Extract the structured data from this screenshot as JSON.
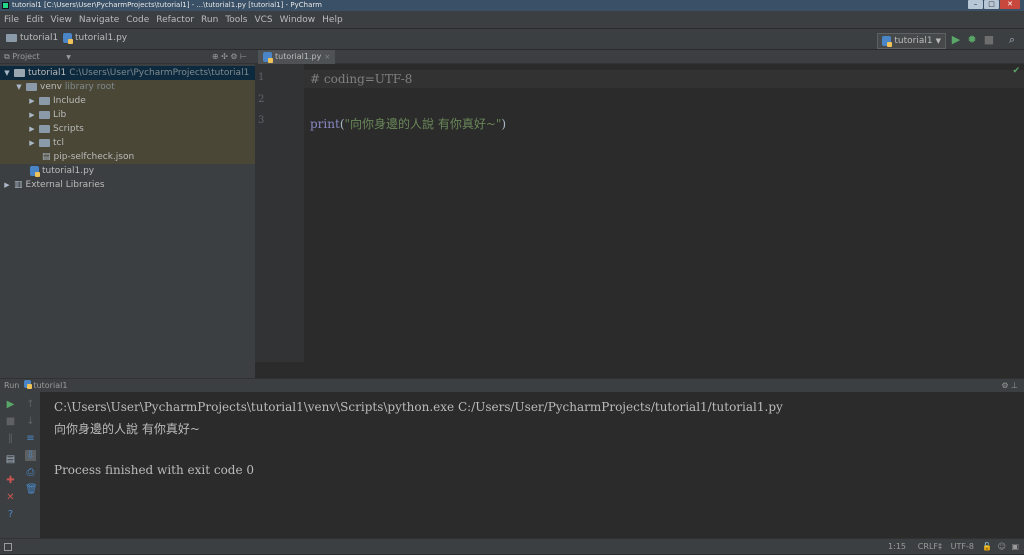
{
  "window": {
    "title": "tutorial1 [C:\\Users\\User\\PycharmProjects\\tutorial1] - ...\\tutorial1.py [tutorial1] - PyCharm"
  },
  "menu": [
    "File",
    "Edit",
    "View",
    "Navigate",
    "Code",
    "Refactor",
    "Run",
    "Tools",
    "VCS",
    "Window",
    "Help"
  ],
  "breadcrumbs": {
    "project": "tutorial1",
    "file": "tutorial1.py"
  },
  "run_config": {
    "name": "tutorial1"
  },
  "project_panel": {
    "header": "Project",
    "tree": [
      {
        "label": "tutorial1",
        "extra": "C:\\Users\\User\\PycharmProjects\\tutorial1"
      },
      {
        "label": "venv",
        "extra": "library root"
      },
      {
        "label": "Include"
      },
      {
        "label": "Lib"
      },
      {
        "label": "Scripts"
      },
      {
        "label": "tcl"
      },
      {
        "label": "pip-selfcheck.json"
      },
      {
        "label": "tutorial1.py"
      },
      {
        "label": "External Libraries"
      }
    ]
  },
  "editor": {
    "tab": "tutorial1.py",
    "line_numbers": [
      "1",
      "2",
      "3"
    ],
    "lines": {
      "comment": "# coding=UTF-8",
      "print_func": "print",
      "paren_open": "(",
      "string": "\"向你身邊的人說 有你真好~\"",
      "paren_close": ")"
    }
  },
  "run_panel": {
    "header_label": "Run",
    "config": "tutorial1",
    "console": [
      "C:\\Users\\User\\PycharmProjects\\tutorial1\\venv\\Scripts\\python.exe C:/Users/User/PycharmProjects/tutorial1/tutorial1.py",
      "向你身邊的人說 有你真好~",
      "",
      "Process finished with exit code 0"
    ]
  },
  "status_bar": {
    "position": "1:15",
    "line_sep": "CRLF",
    "encoding": "UTF-8"
  },
  "colors": {
    "background": "#2b2b2b",
    "panel": "#3c3f41",
    "selection": "#0d293e",
    "comment": "#808080",
    "keyword_func": "#8888c6",
    "string": "#6a8759",
    "run_green": "#59a869"
  }
}
